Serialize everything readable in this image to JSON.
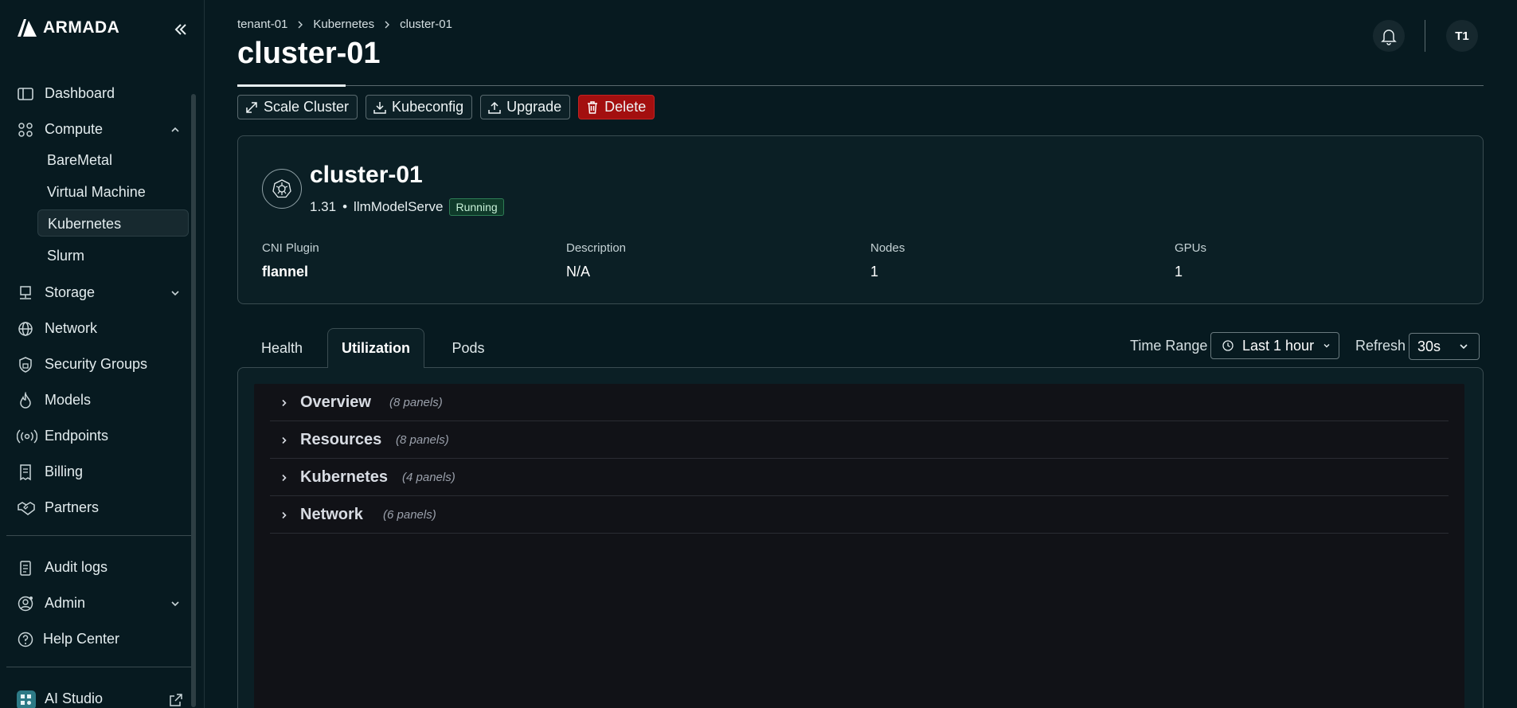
{
  "brand": {
    "name": "ARMADA"
  },
  "sidebar": {
    "items": [
      {
        "label": "Dashboard",
        "icon": "sidebar-panel-icon"
      },
      {
        "label": "Compute",
        "icon": "compute-nodes-icon",
        "expanded": true,
        "children": [
          {
            "label": "BareMetal",
            "active": false
          },
          {
            "label": "Virtual Machine",
            "active": false
          },
          {
            "label": "Kubernetes",
            "active": true
          },
          {
            "label": "Slurm",
            "active": false
          }
        ]
      },
      {
        "label": "Storage",
        "icon": "storage-icon",
        "expanded": false
      },
      {
        "label": "Network",
        "icon": "globe-icon"
      },
      {
        "label": "Security Groups",
        "icon": "lock-icon"
      },
      {
        "label": "Models",
        "icon": "flame-icon"
      },
      {
        "label": "Endpoints",
        "icon": "broadcast-icon"
      },
      {
        "label": "Billing",
        "icon": "receipt-icon"
      },
      {
        "label": "Partners",
        "icon": "handshake-icon"
      }
    ],
    "bottom_items": [
      {
        "label": "Audit logs",
        "icon": "clipboard-icon"
      },
      {
        "label": "Admin",
        "icon": "user-gear-icon",
        "expanded": false
      },
      {
        "label": "Help Center",
        "icon": "help-circle-icon"
      }
    ],
    "footer_item": {
      "label": "AI Studio",
      "icon": "ai-studio-icon",
      "external": true
    }
  },
  "breadcrumb": [
    "tenant-01",
    "Kubernetes",
    "cluster-01"
  ],
  "page_title": "cluster-01",
  "header": {
    "avatar_initials": "T1"
  },
  "actions": {
    "scale_label": "Scale Cluster",
    "kubeconfig_label": "Kubeconfig",
    "upgrade_label": "Upgrade",
    "delete_label": "Delete"
  },
  "cluster": {
    "name": "cluster-01",
    "version": "1.31",
    "dot": "•",
    "workload": "llmModelServe",
    "status": "Running",
    "fields": [
      {
        "key": "CNI Plugin",
        "value": "flannel"
      },
      {
        "key": "Description",
        "value": "N/A"
      },
      {
        "key": "Nodes",
        "value": "1"
      },
      {
        "key": "GPUs",
        "value": "1"
      }
    ]
  },
  "tabs": [
    {
      "label": "Health",
      "active": false
    },
    {
      "label": "Utilization",
      "active": true
    },
    {
      "label": "Pods",
      "active": false
    }
  ],
  "controls": {
    "time_range_label": "Time Range",
    "time_range_value": "Last 1 hour",
    "refresh_label": "Refresh",
    "refresh_value": "30s"
  },
  "panel_rows": [
    {
      "title": "Overview",
      "count": "(8 panels)"
    },
    {
      "title": "Resources",
      "count": "(8 panels)"
    },
    {
      "title": "Kubernetes",
      "count": "(4 panels)"
    },
    {
      "title": "Network",
      "count": "(6 panels)"
    }
  ],
  "colors": {
    "background": "#071a20",
    "danger": "#a30f0f",
    "status_running": "#2e7d55"
  }
}
